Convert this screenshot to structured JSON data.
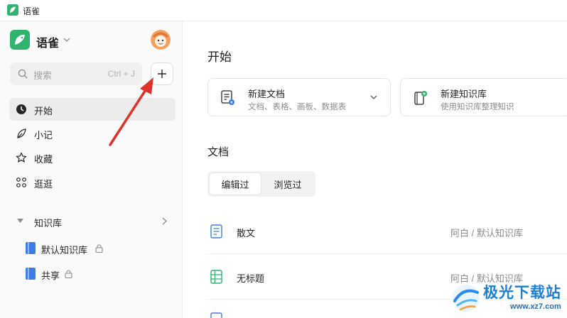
{
  "window": {
    "title": "语雀"
  },
  "app": {
    "name": "语雀"
  },
  "search": {
    "placeholder": "搜索",
    "shortcut": "Ctrl + J"
  },
  "nav": [
    {
      "label": "开始",
      "icon": "clock-icon",
      "active": true
    },
    {
      "label": "小记",
      "icon": "feather-icon",
      "active": false
    },
    {
      "label": "收藏",
      "icon": "star-icon",
      "active": false
    },
    {
      "label": "逛逛",
      "icon": "grid-icon",
      "active": false
    }
  ],
  "knowledge": {
    "label": "知识库",
    "items": [
      {
        "name": "默认知识库",
        "locked": true
      },
      {
        "name": "共享",
        "locked": true
      }
    ]
  },
  "main": {
    "heading": "开始",
    "cards": [
      {
        "title": "新建文档",
        "subtitle": "文档、表格、画板、数据表",
        "icon": "new-doc-icon"
      },
      {
        "title": "新建知识库",
        "subtitle": "使用知识库整理知识",
        "icon": "new-kb-icon"
      }
    ],
    "docs_heading": "文档",
    "tabs": [
      {
        "label": "编辑过",
        "active": true
      },
      {
        "label": "浏览过",
        "active": false
      }
    ],
    "docs": [
      {
        "name": "散文",
        "path": "阿白 / 默认知识库",
        "icon": "doc-icon"
      },
      {
        "name": "无标题",
        "path": "阿白 / 默认知识库",
        "icon": "sheet-icon"
      }
    ]
  },
  "watermark": {
    "text": "极光下载站",
    "url": "www.xz7.com"
  },
  "colors": {
    "brand": "#2fb36f",
    "annotation_arrow": "#e0312b",
    "book": "#3d7ee6"
  }
}
